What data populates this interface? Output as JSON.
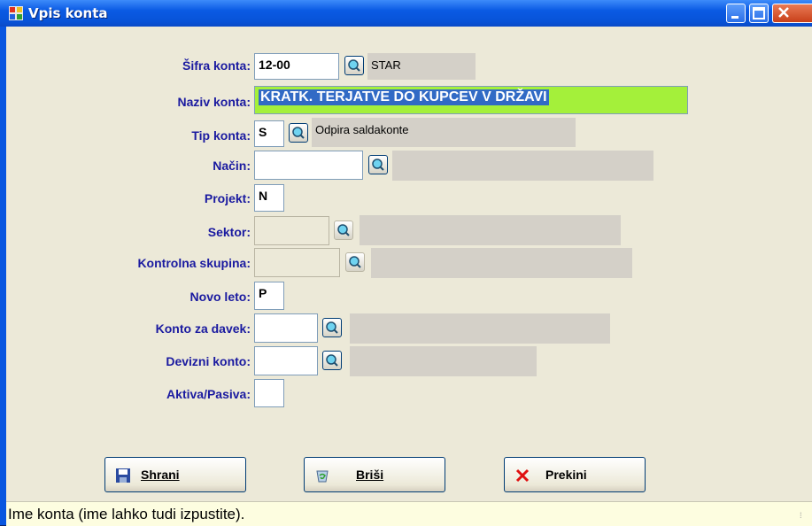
{
  "window": {
    "title": "Vpis konta"
  },
  "form": {
    "sifra": {
      "label": "Šifra konta:",
      "value": "12-00",
      "desc": "STAR"
    },
    "naziv": {
      "label": "Naziv konta:",
      "value": "KRATK. TERJATVE DO KUPCEV V DRŽAVI"
    },
    "tip": {
      "label": "Tip konta:",
      "value": "S",
      "desc": "Odpira saldakonte"
    },
    "nacin": {
      "label": "Način:",
      "value": "",
      "desc": ""
    },
    "projekt": {
      "label": "Projekt:",
      "value": "N"
    },
    "sektor": {
      "label": "Sektor:",
      "value": "",
      "desc": ""
    },
    "kontrolna": {
      "label": "Kontrolna skupina:",
      "value": "",
      "desc": ""
    },
    "novo_leto": {
      "label": "Novo leto:",
      "value": "P"
    },
    "konto_davek": {
      "label": "Konto za davek:",
      "value": "",
      "desc": ""
    },
    "devizni": {
      "label": "Devizni konto:",
      "value": "",
      "desc": ""
    },
    "aktiva": {
      "label": "Aktiva/Pasiva:",
      "value": ""
    }
  },
  "buttons": {
    "shrani": "Shrani",
    "brisi": "Briši",
    "prekini": "Prekini"
  },
  "status": {
    "text": "Ime konta (ime lahko tudi izpustite)."
  },
  "colors": {
    "label": "#1a1aa0",
    "highlight": "#a4f03a",
    "selection": "#316ac5"
  }
}
